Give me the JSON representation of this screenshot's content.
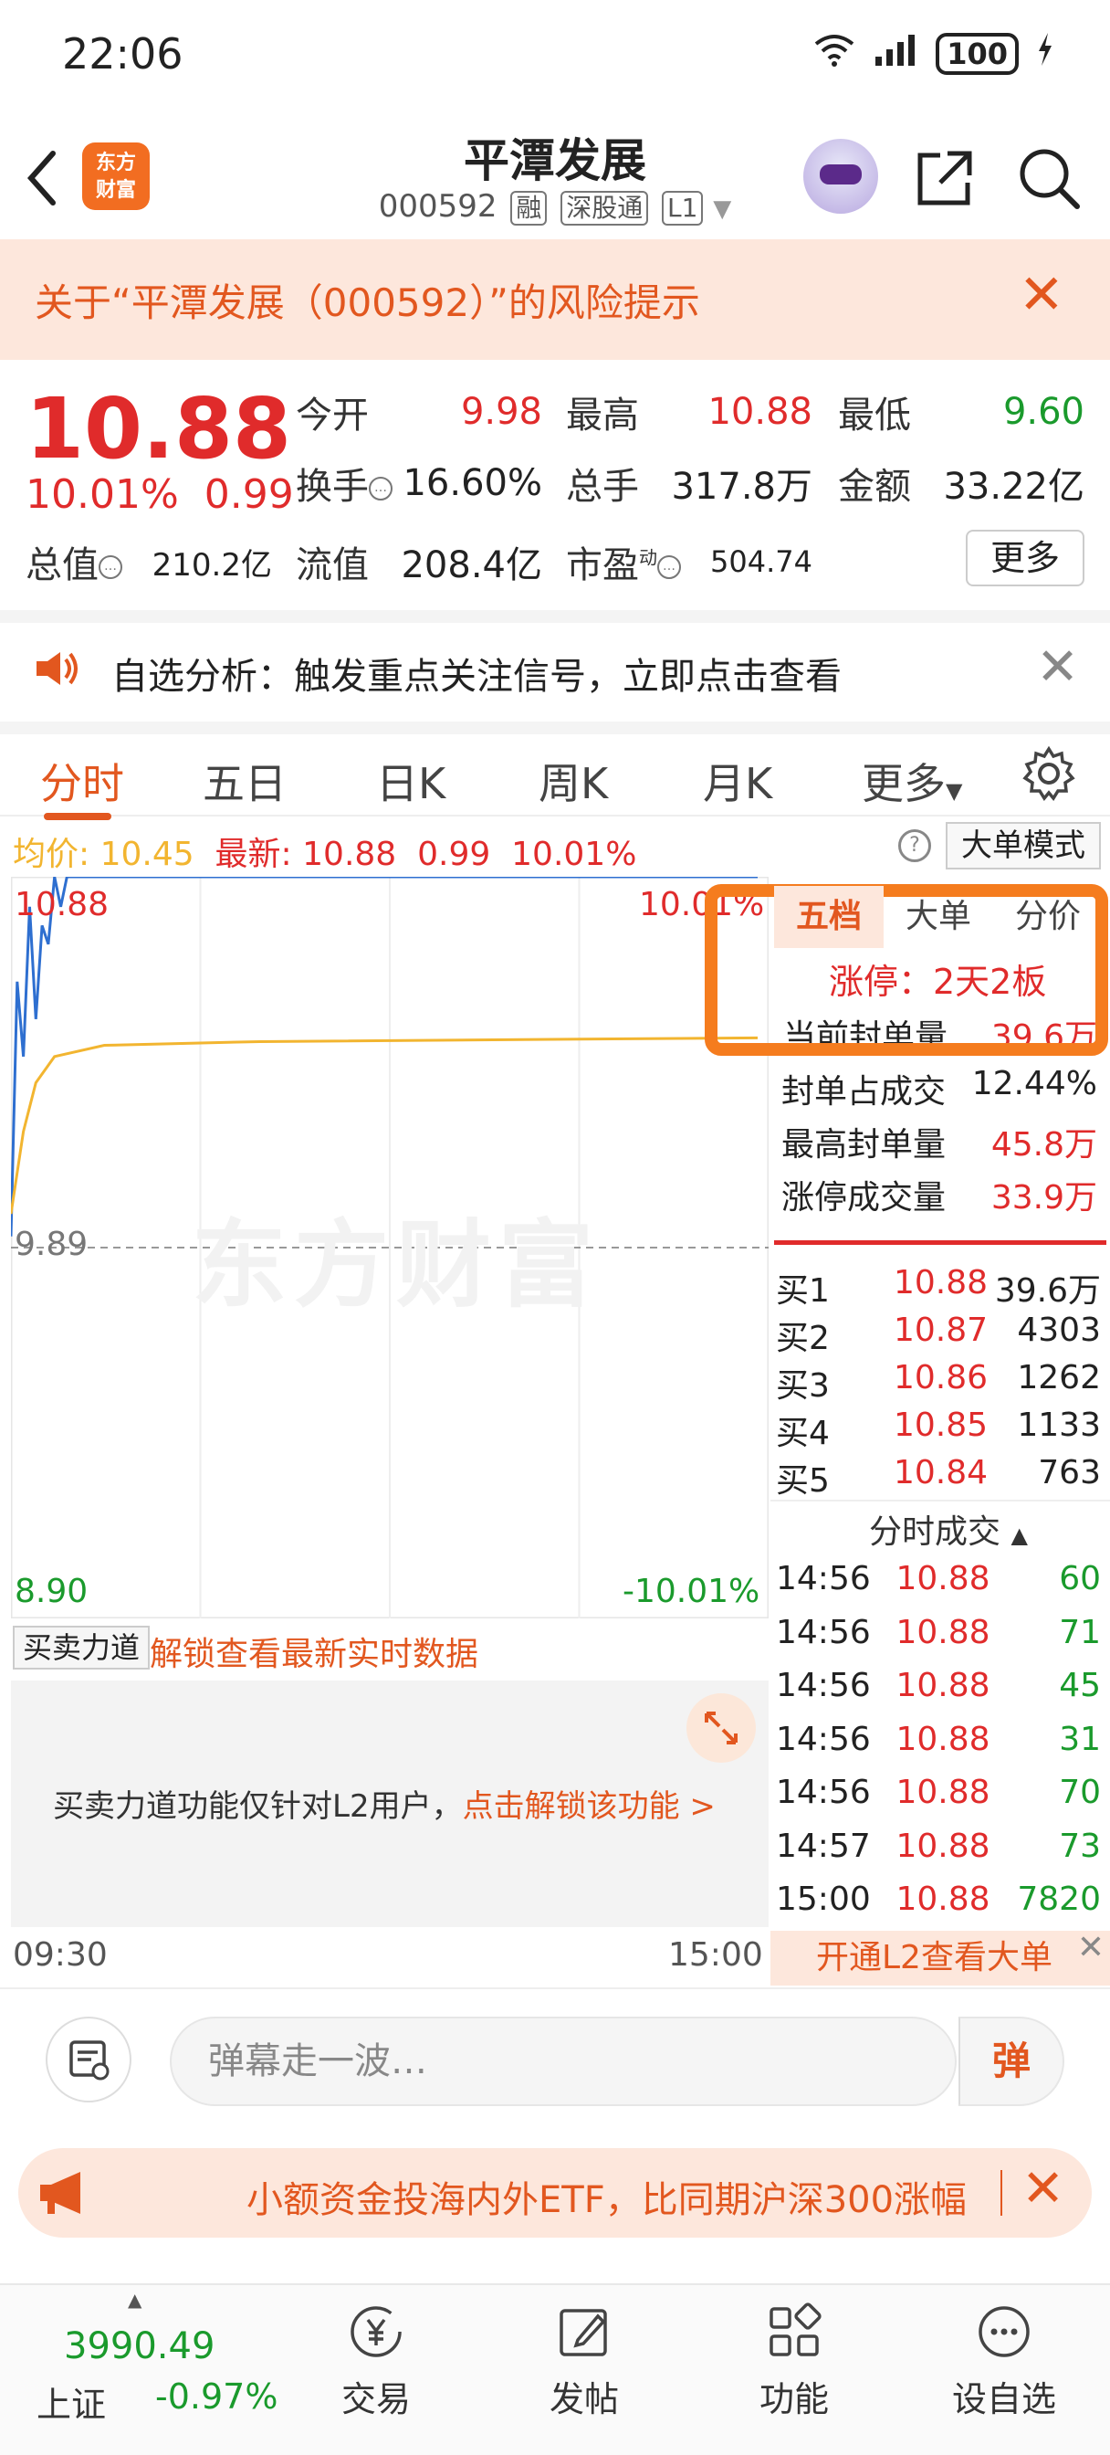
{
  "status_bar": {
    "time": "22:06",
    "signal": "6",
    "battery": "100"
  },
  "header": {
    "title": "平潭发展",
    "code": "000592",
    "tags": [
      "融",
      "深股通",
      "L1"
    ],
    "logo_text": "东方财富"
  },
  "risk_banner": {
    "text": "关于“平潭发展（000592）”的风险提示"
  },
  "quote": {
    "price": "10.88",
    "change_pct": "10.01%",
    "change": "0.99",
    "fields": [
      {
        "label": "今开",
        "value": "9.98",
        "color": "red"
      },
      {
        "label": "最高",
        "value": "10.88",
        "color": "red"
      },
      {
        "label": "最低",
        "value": "9.60",
        "color": "green"
      },
      {
        "label": "换手",
        "value": "16.60%",
        "color": "dark"
      },
      {
        "label": "总手",
        "value": "317.8万",
        "color": "dark"
      },
      {
        "label": "金额",
        "value": "33.22亿",
        "color": "dark"
      },
      {
        "label": "总值",
        "value": "210.2亿",
        "color": "dark"
      },
      {
        "label": "流值",
        "value": "208.4亿",
        "color": "dark"
      },
      {
        "label": "市盈",
        "value": "504.74",
        "color": "dark"
      }
    ],
    "pe_sup": "动",
    "more_label": "更多"
  },
  "alert": {
    "text": "自选分析：触发重点关注信号，立即点击查看"
  },
  "tabs": [
    "分时",
    "五日",
    "日K",
    "周K",
    "月K",
    "更多"
  ],
  "avg_row": {
    "avg_label": "均价:",
    "avg_value": "10.45",
    "latest_label": "最新:",
    "latest_value": "10.88",
    "latest_change": "0.99",
    "latest_pct": "10.01%",
    "big_order_mode": "大单模式"
  },
  "chart_data": {
    "type": "line",
    "title": "",
    "xlabel": "",
    "ylabel": "",
    "x_ticks": [
      "09:30",
      "15:00"
    ],
    "y_ticks_left": [
      "10.88",
      "9.89",
      "8.90"
    ],
    "y_ticks_right": [
      "10.01%",
      "-10.01%"
    ],
    "ylim": [
      8.9,
      10.88
    ],
    "prev_close": 9.89,
    "series": [
      {
        "name": "",
        "color": "#2e6fd0",
        "points": [
          [
            0,
            9.92
          ],
          [
            2,
            10.6
          ],
          [
            4,
            10.4
          ],
          [
            6,
            10.8
          ],
          [
            8,
            10.5
          ],
          [
            10,
            10.75
          ],
          [
            12,
            10.7
          ],
          [
            14,
            10.88
          ],
          [
            16,
            10.8
          ],
          [
            18,
            10.88
          ],
          [
            240,
            10.88
          ]
        ]
      },
      {
        "name": "",
        "color": "#f2b530",
        "points": [
          [
            0,
            9.98
          ],
          [
            4,
            10.2
          ],
          [
            8,
            10.33
          ],
          [
            14,
            10.4
          ],
          [
            30,
            10.43
          ],
          [
            80,
            10.44
          ],
          [
            240,
            10.45
          ]
        ]
      }
    ],
    "watermark": "东方财富"
  },
  "right_panel": {
    "tabs": [
      "五档",
      "大单",
      "分价"
    ],
    "limit_up": "涨停：2天2板",
    "current_seal_label": "当前封单量",
    "current_seal_value": "39.6万",
    "stats": [
      {
        "label": "封单占成交",
        "value": "12.44%",
        "color": "dark"
      },
      {
        "label": "最高封单量",
        "value": "45.8万",
        "color": "red"
      },
      {
        "label": "涨停成交量",
        "value": "33.9万",
        "color": "red"
      }
    ],
    "bids": [
      {
        "label": "买1",
        "price": "10.88",
        "vol": "39.6万"
      },
      {
        "label": "买2",
        "price": "10.87",
        "vol": "4303"
      },
      {
        "label": "买3",
        "price": "10.86",
        "vol": "1262"
      },
      {
        "label": "买4",
        "price": "10.85",
        "vol": "1133"
      },
      {
        "label": "买5",
        "price": "10.84",
        "vol": "763"
      }
    ],
    "ticks_header": "分时成交",
    "ticks": [
      {
        "time": "14:56",
        "price": "10.88",
        "vol": "60"
      },
      {
        "time": "14:56",
        "price": "10.88",
        "vol": "71"
      },
      {
        "time": "14:56",
        "price": "10.88",
        "vol": "45"
      },
      {
        "time": "14:56",
        "price": "10.88",
        "vol": "31"
      },
      {
        "time": "14:56",
        "price": "10.88",
        "vol": "70"
      },
      {
        "time": "14:57",
        "price": "10.88",
        "vol": "73"
      },
      {
        "time": "15:00",
        "price": "10.88",
        "vol": "7820"
      }
    ],
    "open_l2": "开通L2查看大单"
  },
  "force_bar": {
    "select_label": "买卖力道",
    "unlock_link": "解锁查看最新实时数据",
    "locked_text": "买卖力道功能仅针对L2用户，",
    "locked_link": "点击解锁该功能 >"
  },
  "comment": {
    "placeholder": "弹幕走一波…",
    "danmu_label": "弹"
  },
  "ad": {
    "text": "小额资金投海内外ETF，比同期沪深300涨幅"
  },
  "bottom_nav": {
    "index_value": "3990.49",
    "index_name": "上证",
    "index_change": "-0.97%",
    "items": [
      "交易",
      "发帖",
      "功能",
      "设自选"
    ]
  },
  "colors": {
    "accent": "#e2571f",
    "up": "#e02b2b",
    "down": "#1a9a2c",
    "highlight_box": "#f57c1e"
  }
}
